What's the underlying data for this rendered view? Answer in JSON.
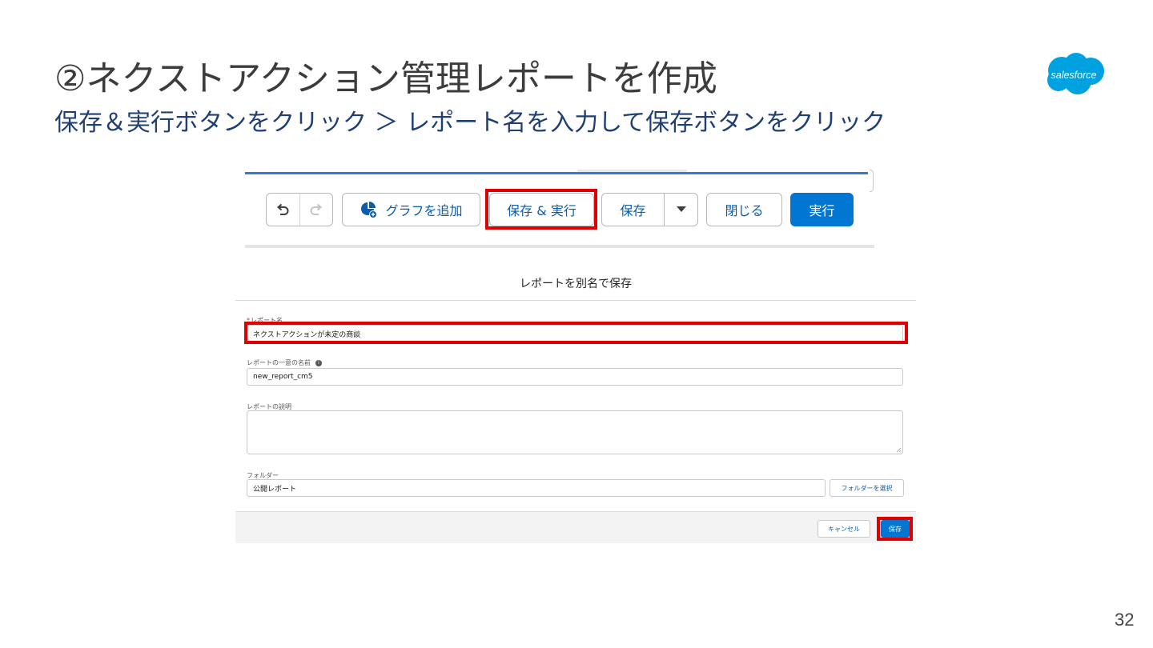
{
  "slide": {
    "title": "②ネクストアクション管理レポートを作成",
    "subtitle": "保存＆実行ボタンをクリック ＞ レポート名を入力して保存ボタンをクリック",
    "page_number": "32",
    "logo_text": "salesforce"
  },
  "toolbar": {
    "add_chart_label": "グラフを追加",
    "save_run_label": "保存 & 実行",
    "save_label": "保存",
    "close_label": "閉じる",
    "run_label": "実行"
  },
  "dialog": {
    "title": "レポートを別名で保存",
    "report_name": {
      "required_mark": "*",
      "label": "レポート名",
      "value": "ネクストアクションが未定の商談"
    },
    "unique_name": {
      "label": "レポートの一意の名前",
      "value": "new_report_cm5"
    },
    "description": {
      "label": "レポートの説明",
      "value": ""
    },
    "folder": {
      "label": "フォルダー",
      "value": "公開レポート",
      "select_button": "フォルダーを選択"
    },
    "cancel_label": "キャンセル",
    "save_label": "保存"
  },
  "colors": {
    "highlight": "#e10000",
    "brand_blue": "#0176d3",
    "subtitle_blue": "#1f3f73",
    "logo_blue": "#00a1e0"
  }
}
